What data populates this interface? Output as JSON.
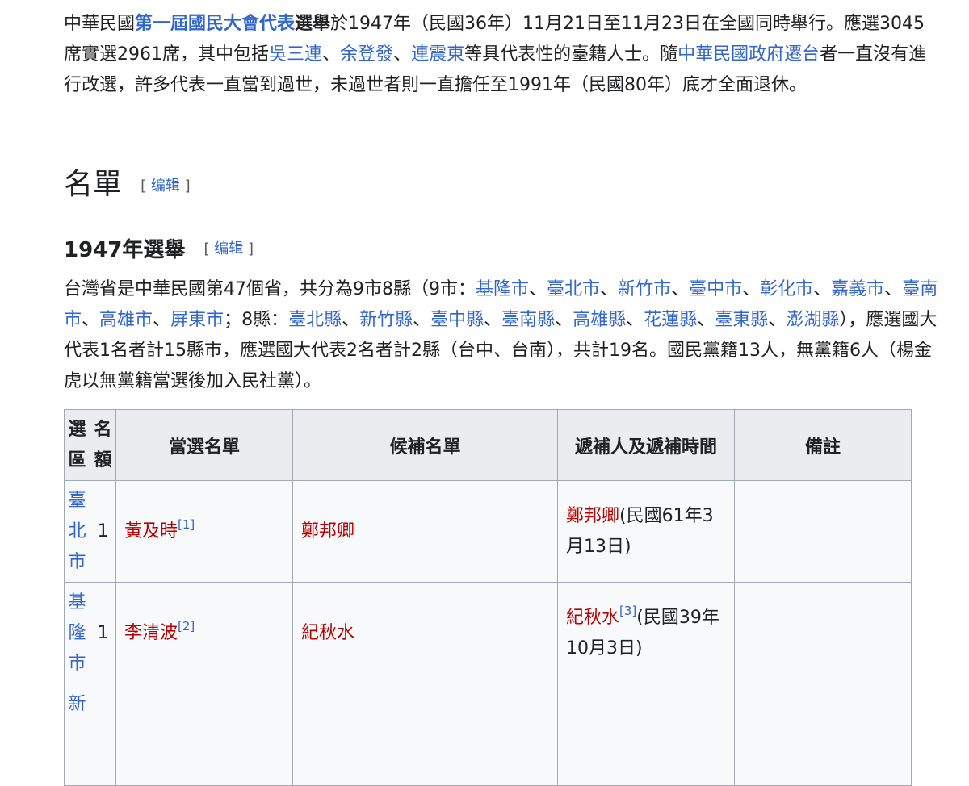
{
  "intro": {
    "p1": "中華民國",
    "link_delegate": "第一屆國民大會代表",
    "p2": "選舉",
    "p3": "於1947年（民國36年）11月21日至11月23日在全國同時舉行。應選3045席實選2961席，其中包括",
    "link_wu": "吳三連",
    "sep1": "、",
    "link_yu": "余登發",
    "sep2": "、",
    "link_lian": "連震東",
    "p4": "等具代表性的臺籍人士。隨",
    "link_gov": "中華民國政府遷台",
    "p5": "者一直沒有進行改選，許多代表一直當到過世，未過世者則一直擔任至1991年（民國80年）底才全面退休。"
  },
  "section_list": {
    "title": "名單",
    "edit_open": "[ ",
    "edit_label": "编辑",
    "edit_close": " ]"
  },
  "section_1947": {
    "title": "1947年選舉",
    "edit_open": "[ ",
    "edit_label": "编辑",
    "edit_close": " ]"
  },
  "province": {
    "p1": "台灣省是中華民國第47個省，共分為9市8縣（9市：",
    "cities": [
      "基隆市",
      "臺北市",
      "新竹市",
      "臺中市",
      "彰化市",
      "嘉義市",
      "臺南市",
      "高雄市",
      "屏東市"
    ],
    "p2": "；8縣：",
    "counties": [
      "臺北縣",
      "新竹縣",
      "臺中縣",
      "臺南縣",
      "高雄縣",
      "花蓮縣",
      "臺東縣",
      "澎湖縣"
    ],
    "p3": "），應選國大代表1名者計15縣市，應選國大代表2名者計2縣（台中、台南），共計19名。國民黨籍13人，無黨籍6人（楊金虎以無黨籍當選後加入民社黨）。"
  },
  "table": {
    "headers": [
      "選區",
      "名額",
      "當選名單",
      "候補名單",
      "遞補人及遞補時間",
      "備註"
    ],
    "rows": [
      {
        "district": "臺北市",
        "seats": "1",
        "elected": "黃及時",
        "elected_ref": "[1]",
        "alternate": "鄭邦卿",
        "replacement": "鄭邦卿",
        "replacement_ref": "",
        "replacement_time": "(民國61年3月13日)",
        "note": ""
      },
      {
        "district": "基隆市",
        "seats": "1",
        "elected": "李清波",
        "elected_ref": "[2]",
        "alternate": "紀秋水",
        "replacement": "紀秋水",
        "replacement_ref": "[3]",
        "replacement_time": "(民國39年10月3日)",
        "note": ""
      },
      {
        "district": "新",
        "seats": "",
        "elected": "",
        "elected_ref": "",
        "alternate": "",
        "replacement": "",
        "replacement_ref": "",
        "replacement_time": "",
        "note": ""
      }
    ]
  }
}
